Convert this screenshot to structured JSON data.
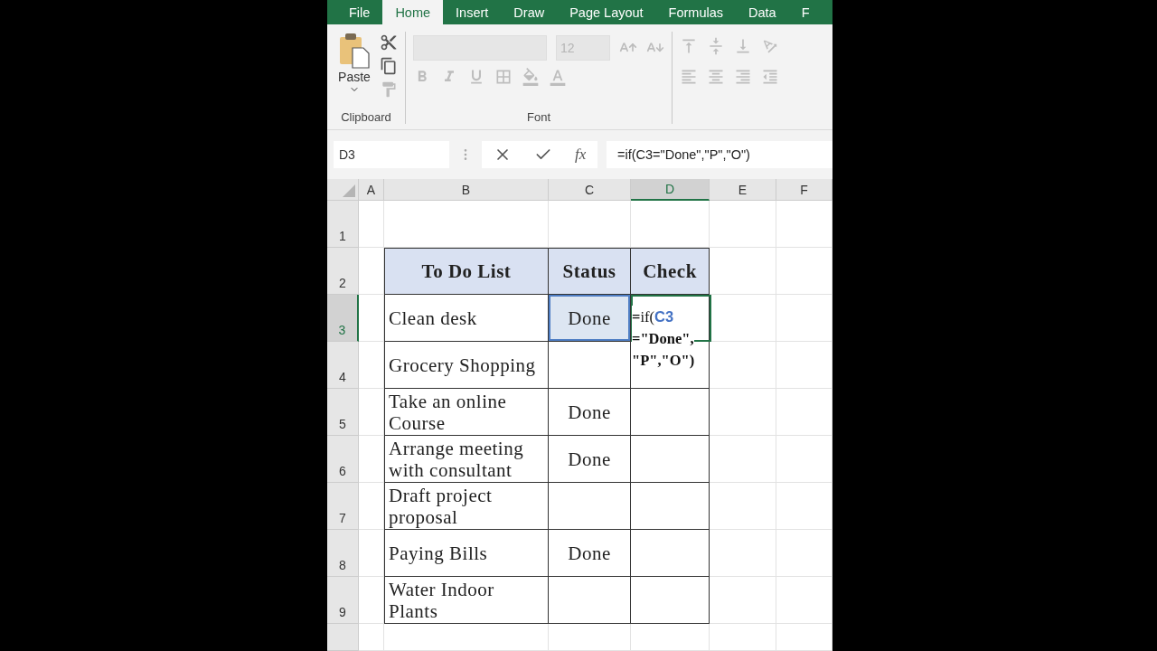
{
  "ribbon_tabs": [
    {
      "label": "File",
      "selected": false
    },
    {
      "label": "Home",
      "selected": true
    },
    {
      "label": "Insert",
      "selected": false
    },
    {
      "label": "Draw",
      "selected": false
    },
    {
      "label": "Page Layout",
      "selected": false
    },
    {
      "label": "Formulas",
      "selected": false
    },
    {
      "label": "Data",
      "selected": false
    },
    {
      "label": "F",
      "selected": false
    }
  ],
  "clipboard": {
    "paste_label": "Paste",
    "group_label": "Clipboard",
    "tools": [
      {
        "kind": "cut",
        "disabled": false
      },
      {
        "kind": "copy",
        "disabled": false
      },
      {
        "kind": "format_painter",
        "disabled": true
      }
    ]
  },
  "font": {
    "group_label": "Font",
    "font_size": "12",
    "disabled": true
  },
  "formula_bar": {
    "name_box": "D3",
    "fx": "fx",
    "formula": "=if(C3=\"Done\",\"P\",\"O\")"
  },
  "columns": [
    {
      "label": "A",
      "selected": false
    },
    {
      "label": "B",
      "selected": false
    },
    {
      "label": "C",
      "selected": false
    },
    {
      "label": "D",
      "selected": true
    },
    {
      "label": "E",
      "selected": false
    },
    {
      "label": "F",
      "selected": false
    }
  ],
  "row_numbers": [
    {
      "label": "1",
      "selected": false
    },
    {
      "label": "2",
      "selected": false
    },
    {
      "label": "3",
      "selected": true
    },
    {
      "label": "4",
      "selected": false
    },
    {
      "label": "5",
      "selected": false
    },
    {
      "label": "6",
      "selected": false
    },
    {
      "label": "7",
      "selected": false
    },
    {
      "label": "8",
      "selected": false
    },
    {
      "label": "9",
      "selected": false
    }
  ],
  "table": {
    "headers": [
      "To Do List",
      "Status",
      "Check"
    ],
    "rows": [
      {
        "task": "Clean desk",
        "status": "Done",
        "referenced": true
      },
      {
        "task": "Grocery Shopping",
        "referenced": false
      },
      {
        "task": "Take an online Course",
        "status": "Done",
        "referenced": false
      },
      {
        "task": "Arrange meeting with consultant",
        "status": "Done",
        "referenced": false
      },
      {
        "task": "Draft project proposal",
        "referenced": false
      },
      {
        "task": "Paying Bills",
        "status": "Done",
        "referenced": false
      },
      {
        "task": "Water Indoor Plants",
        "referenced": false
      }
    ]
  },
  "cell_editor": {
    "lines": [
      [
        {
          "text": "=",
          "kind": "bold"
        },
        {
          "text": "if(",
          "kind": "plain"
        },
        {
          "text": "C3",
          "kind": "ref"
        }
      ],
      [
        {
          "text": "=\"Done\",",
          "kind": "bold"
        }
      ],
      [
        {
          "text": "\"P\",\"O\")",
          "kind": "bold"
        }
      ]
    ]
  }
}
